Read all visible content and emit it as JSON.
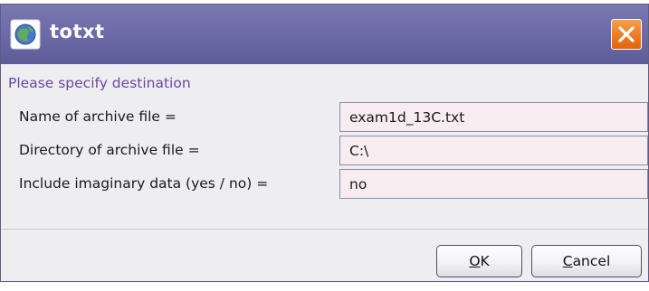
{
  "window": {
    "title": "totxt",
    "icon": "app-globe-icon",
    "close_icon": "close-icon"
  },
  "prompt": "Please specify destination",
  "fields": [
    {
      "label": "Name of archive file =",
      "value": "exam1d_13C.txt"
    },
    {
      "label": "Directory of archive file =",
      "value": "C:\\"
    },
    {
      "label": "Include imaginary data (yes / no) =",
      "value": "no"
    }
  ],
  "buttons": {
    "ok": {
      "mnemonic": "O",
      "rest": "K"
    },
    "cancel": {
      "mnemonic": "C",
      "rest": "ancel"
    }
  },
  "colors": {
    "titlebar": "#6e6ca8",
    "prompt_text": "#6a45a8",
    "input_background": "#f7ecef",
    "close_button": "#ef7a1e"
  }
}
